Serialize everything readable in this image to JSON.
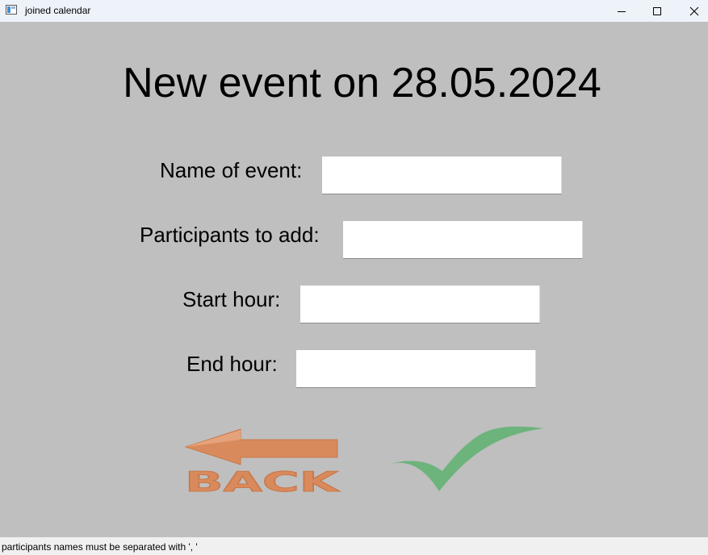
{
  "window": {
    "title": "joined calendar"
  },
  "heading": "New event on 28.05.2024",
  "form": {
    "name_label": "Name of event:",
    "name_value": "",
    "participants_label": "Participants to add:",
    "participants_value": "",
    "start_label": "Start hour:",
    "start_value": "",
    "end_label": "End hour:",
    "end_value": ""
  },
  "buttons": {
    "back_label": "BACK",
    "back_icon": "back-arrow-icon",
    "confirm_icon": "checkmark-icon"
  },
  "colors": {
    "background": "#bfbfbf",
    "back_orange": "#d98a5c",
    "check_green": "#6db37c"
  },
  "statusbar": {
    "text": "participants names must be separated with ', '"
  }
}
